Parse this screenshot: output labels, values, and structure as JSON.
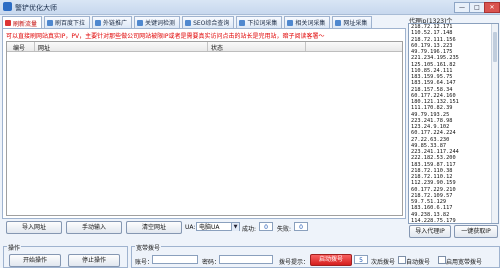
{
  "window": {
    "title": "警铲优化大师",
    "min_label": "—",
    "max_label": "□",
    "close_label": "✕"
  },
  "tabs": [
    {
      "label": "刷新流量",
      "icon": "refresh-icon"
    },
    {
      "label": "刷百度下拉",
      "icon": "dropdown-icon"
    },
    {
      "label": "外链推广",
      "icon": "link-icon"
    },
    {
      "label": "关键词检测",
      "icon": "keyword-icon"
    },
    {
      "label": "SEO综合查询",
      "icon": "seo-icon"
    },
    {
      "label": "下拉词采集",
      "icon": "collect-icon"
    },
    {
      "label": "相关词采集",
      "icon": "related-icon"
    },
    {
      "label": "网址采集",
      "icon": "url-icon"
    }
  ],
  "notice": "可以直接刷网站真实IP，PV，主要针对那些做公司网站被限IP或者是需要真实访问点击的站长是完用站，暗子阅读客署～",
  "grid": {
    "columns": [
      "编号",
      "网址",
      "状态"
    ],
    "rows": []
  },
  "toolbar": {
    "import_url": "导入网址",
    "manual_input": "手动输入",
    "clear_url": "清空网址",
    "ua_label": "UA:",
    "ua_value": "电脑UA",
    "success_label": "成功:",
    "success_value": "0",
    "fail_label": "失败:",
    "fail_value": "0"
  },
  "proxy": {
    "title": "代理ip(1323)个",
    "import_button": "导入代理IP",
    "collect_button": "一键获取IP",
    "ips": [
      "218.72.12.171",
      "110.52.17.148",
      "218.72.111.156",
      "60.179.13.223",
      "49.79.196.175",
      "221.234.195.235",
      "125.105.161.82",
      "110.85.24.111",
      "183.159.95.75",
      "183.159.64.147",
      "218.157.58.34",
      "60.177.224.160",
      "180.121.132.151",
      "111.170.82.39",
      "49.79.193.25",
      "223.241.78.98",
      "123.24.9.102",
      "60.177.224.224",
      "27.22.63.230",
      "49.85.33.87",
      "223.241.117.244",
      "222.182.53.200",
      "183.159.87.117",
      "218.72.110.38",
      "218.72.110.12",
      "112.239.90.159",
      "60.177.229.210",
      "218.72.109.57",
      "59.7.51.129",
      "183.160.6.117",
      "49.238.13.82",
      "114.228.75.179"
    ]
  },
  "bottom": {
    "operation_group": "操作",
    "start_button": "开始操作",
    "stop_button": "停止操作",
    "broadband_group": "宽带拨号",
    "account_label": "账号：",
    "password_label": "密码：",
    "dial_hint": "拨号提示：",
    "dial_button": "启动拨号",
    "interval_value": "5",
    "interval_unit": "次后拨号",
    "auto_label": "自动拨号",
    "check_label": "启用宽带拨号"
  }
}
